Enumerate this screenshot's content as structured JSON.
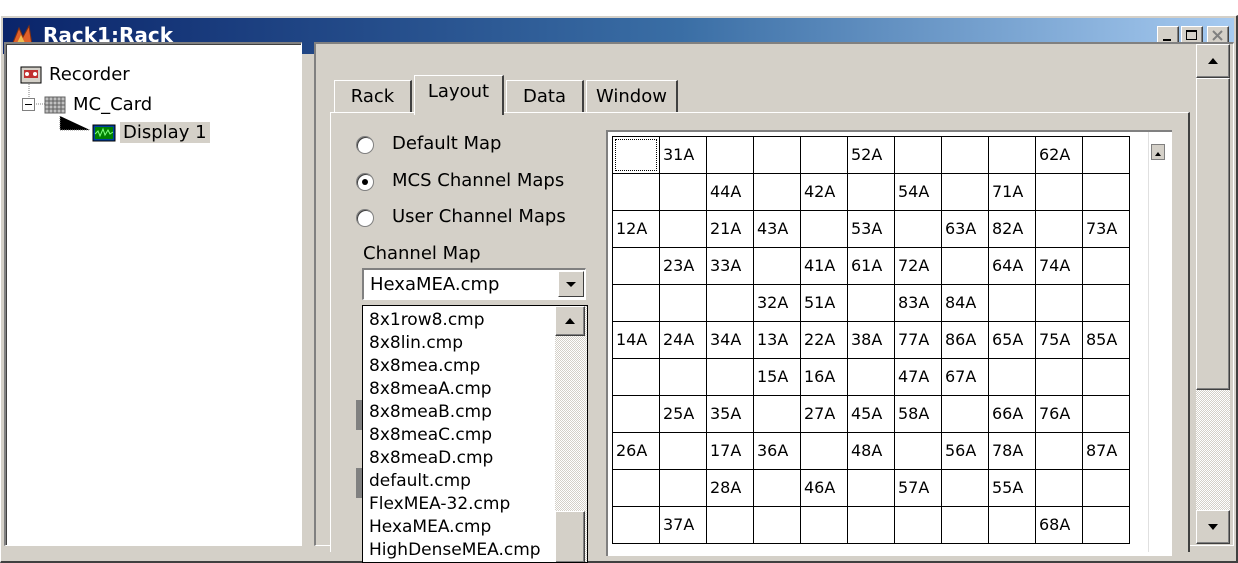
{
  "window": {
    "title": "Rack1:Rack",
    "controls": [
      "minimize",
      "maximize",
      "close"
    ]
  },
  "tree": {
    "items": [
      {
        "label": "Recorder",
        "icon": "recorder-icon"
      },
      {
        "label": "MC_Card",
        "icon": "card-icon"
      },
      {
        "label": "Display 1",
        "icon": "display-icon"
      }
    ]
  },
  "tabs": [
    {
      "label": "Rack"
    },
    {
      "label": "Layout"
    },
    {
      "label": "Data"
    },
    {
      "label": "Window"
    }
  ],
  "layout": {
    "radio_options": [
      {
        "label": "Default Map",
        "checked": false
      },
      {
        "label": "MCS Channel Maps",
        "checked": true
      },
      {
        "label": "User Channel Maps",
        "checked": false
      }
    ],
    "channel_map_label": "Channel Map",
    "channel_map_value": "HexaMEA.cmp",
    "channel_map_options": [
      "8x1row8.cmp",
      "8x8lin.cmp",
      "8x8mea.cmp",
      "8x8meaA.cmp",
      "8x8meaB.cmp",
      "8x8meaC.cmp",
      "8x8meaD.cmp",
      "default.cmp",
      "FlexMEA-32.cmp",
      "HexaMEA.cmp",
      "HighDenseMEA.cmp"
    ],
    "grid": [
      [
        "",
        "31A",
        "",
        "",
        "",
        "52A",
        "",
        "",
        "",
        "62A",
        ""
      ],
      [
        "",
        "",
        "44A",
        "",
        "42A",
        "",
        "54A",
        "",
        "71A",
        "",
        ""
      ],
      [
        "12A",
        "",
        "21A",
        "43A",
        "",
        "53A",
        "",
        "63A",
        "82A",
        "",
        "73A"
      ],
      [
        "",
        "23A",
        "33A",
        "",
        "41A",
        "61A",
        "72A",
        "",
        "64A",
        "74A",
        ""
      ],
      [
        "",
        "",
        "",
        "32A",
        "51A",
        "",
        "83A",
        "84A",
        "",
        "",
        ""
      ],
      [
        "14A",
        "24A",
        "34A",
        "13A",
        "22A",
        "38A",
        "77A",
        "86A",
        "65A",
        "75A",
        "85A"
      ],
      [
        "",
        "",
        "",
        "15A",
        "16A",
        "",
        "47A",
        "67A",
        "",
        "",
        ""
      ],
      [
        "",
        "25A",
        "35A",
        "",
        "27A",
        "45A",
        "58A",
        "",
        "66A",
        "76A",
        ""
      ],
      [
        "26A",
        "",
        "17A",
        "36A",
        "",
        "48A",
        "",
        "56A",
        "78A",
        "",
        "87A"
      ],
      [
        "",
        "",
        "28A",
        "",
        "46A",
        "",
        "57A",
        "",
        "55A",
        "",
        ""
      ],
      [
        "",
        "37A",
        "",
        "",
        "",
        "",
        "",
        "",
        "",
        "68A",
        ""
      ]
    ]
  }
}
